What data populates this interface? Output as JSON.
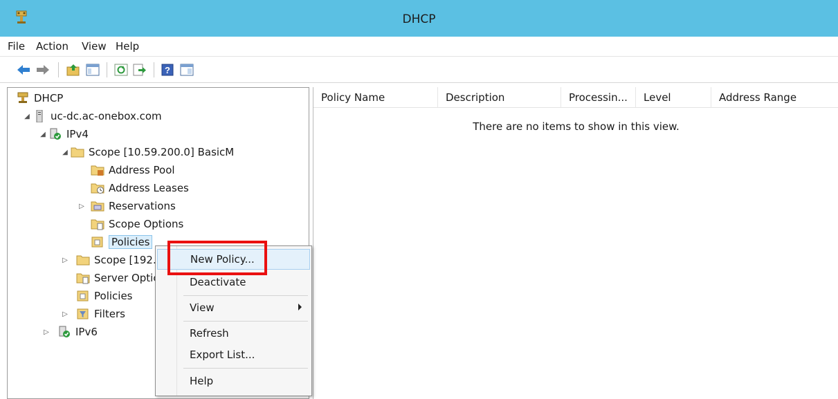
{
  "window": {
    "title": "DHCP"
  },
  "menubar": {
    "items": [
      "File",
      "Action",
      "View",
      "Help"
    ]
  },
  "toolbar": {
    "buttons": [
      "back-arrow-icon",
      "forward-arrow-icon",
      "up-folder-icon",
      "show-hide-tree-icon",
      "refresh-icon",
      "export-list-icon",
      "help-icon",
      "properties-icon"
    ]
  },
  "tree": {
    "root": "DHCP",
    "server": "uc-dc.ac-onebox.com",
    "ipv4": "IPv4",
    "scope1": "Scope [10.59.200.0] BasicM",
    "address_pool": "Address Pool",
    "address_leases": "Address Leases",
    "reservations": "Reservations",
    "scope_options": "Scope Options",
    "policies_scope": "Policies",
    "scope2": "Scope [192.",
    "server_options": "Server Optic",
    "policies_server": "Policies",
    "filters": "Filters",
    "ipv6": "IPv6"
  },
  "list": {
    "columns": [
      "Policy Name",
      "Description",
      "Processin...",
      "Level",
      "Address Range"
    ],
    "empty_message": "There are no items to show in this view."
  },
  "context_menu": {
    "items": [
      "New Policy...",
      "Deactivate",
      "View",
      "Refresh",
      "Export List...",
      "Help"
    ]
  },
  "colors": {
    "titlebar": "#5bc0e3",
    "highlight_box": "#ea1010",
    "menu_highlight": "#e4f1fb"
  }
}
